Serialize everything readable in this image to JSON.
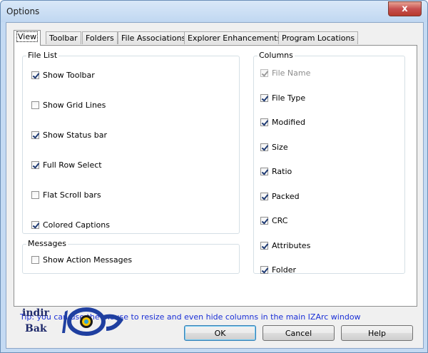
{
  "window": {
    "title": "Options",
    "close_label": "x"
  },
  "tabs": [
    {
      "label": "View",
      "active": true
    },
    {
      "label": "Toolbar"
    },
    {
      "label": "Folders"
    },
    {
      "label": "File Associations"
    },
    {
      "label": "Explorer Enhancements"
    },
    {
      "label": "Program Locations"
    }
  ],
  "file_list": {
    "title": "File List",
    "items": [
      {
        "label": "Show Toolbar",
        "checked": true
      },
      {
        "label": "Show Grid Lines",
        "checked": false
      },
      {
        "label": "Show Status bar",
        "checked": true
      },
      {
        "label": "Full Row Select",
        "checked": true
      },
      {
        "label": "Flat Scroll bars",
        "checked": false
      },
      {
        "label": "Colored Captions",
        "checked": true
      }
    ]
  },
  "messages": {
    "title": "Messages",
    "items": [
      {
        "label": "Show Action Messages",
        "checked": false
      }
    ]
  },
  "columns": {
    "title": "Columns",
    "items": [
      {
        "label": "File Name",
        "checked": true,
        "disabled": true
      },
      {
        "label": "File Type",
        "checked": true
      },
      {
        "label": "Modified",
        "checked": true
      },
      {
        "label": "Size",
        "checked": true
      },
      {
        "label": "Ratio",
        "checked": true
      },
      {
        "label": "Packed",
        "checked": true
      },
      {
        "label": "CRC",
        "checked": true
      },
      {
        "label": "Attributes",
        "checked": true
      },
      {
        "label": "Folder",
        "checked": true
      }
    ]
  },
  "tip": "Tip: you can use the mouse to resize and even hide columns in the main IZArc window",
  "buttons": {
    "ok": "OK",
    "cancel": "Cancel",
    "help": "Help"
  },
  "watermark": {
    "line1": "indir",
    "line2": "Bak"
  },
  "colors": {
    "tip_text": "#1a2fd6",
    "title_bar": "#c4daf3",
    "close_button": "#c75050"
  }
}
